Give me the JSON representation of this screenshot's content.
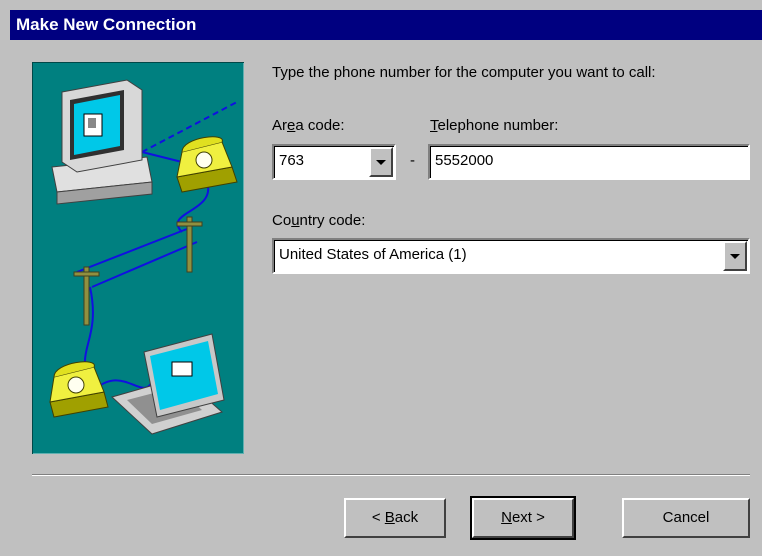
{
  "dialog": {
    "title": "Make New Connection",
    "instruction": "Type the phone number for the computer you want to call:"
  },
  "area_code": {
    "label_accel": "A",
    "label_rest1": "r",
    "label_u": "e",
    "label_rest2": "a code:",
    "value": "763"
  },
  "telephone": {
    "label_u": "T",
    "label_rest": "elephone number:",
    "value": "5552000",
    "separator": "-"
  },
  "country": {
    "label_pre": "Co",
    "label_u": "u",
    "label_rest": "ntry code:",
    "value": "United States of America (1)"
  },
  "buttons": {
    "back_pre": "< ",
    "back_u": "B",
    "back_rest": "ack",
    "next_u": "N",
    "next_rest": "ext >",
    "cancel": "Cancel"
  },
  "icons": [
    "desktop-computer-icon",
    "telephone-icon",
    "utility-pole-icon",
    "laptop-computer-icon"
  ],
  "colors": {
    "titlebar": "#000080",
    "dialog": "#c0c0c0",
    "art_background": "#008080",
    "wire": "#0000ff"
  }
}
